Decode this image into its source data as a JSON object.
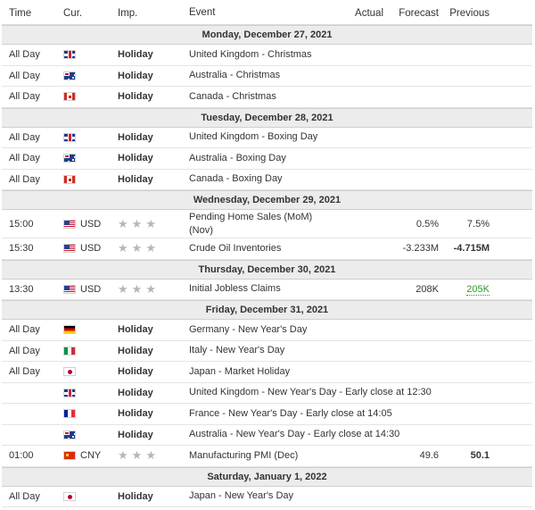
{
  "header": {
    "time": "Time",
    "currency": "Cur.",
    "importance": "Imp.",
    "event": "Event",
    "actual": "Actual",
    "forecast": "Forecast",
    "previous": "Previous"
  },
  "colors": {
    "previous_better": "#2e9a2e",
    "day_band": "#ececec"
  },
  "days": [
    {
      "label": "Monday, December 27, 2021",
      "events": [
        {
          "time": "All Day",
          "flag": "gb",
          "currency": "",
          "importance": "Holiday",
          "stars": 0,
          "event": "United Kingdom - Christmas",
          "actual": "",
          "forecast": "",
          "previous": ""
        },
        {
          "time": "All Day",
          "flag": "au",
          "currency": "",
          "importance": "Holiday",
          "stars": 0,
          "event": "Australia - Christmas",
          "actual": "",
          "forecast": "",
          "previous": ""
        },
        {
          "time": "All Day",
          "flag": "ca",
          "currency": "",
          "importance": "Holiday",
          "stars": 0,
          "event": "Canada - Christmas",
          "actual": "",
          "forecast": "",
          "previous": ""
        }
      ]
    },
    {
      "label": "Tuesday, December 28, 2021",
      "events": [
        {
          "time": "All Day",
          "flag": "gb",
          "currency": "",
          "importance": "Holiday",
          "stars": 0,
          "event": "United Kingdom - Boxing Day",
          "actual": "",
          "forecast": "",
          "previous": ""
        },
        {
          "time": "All Day",
          "flag": "au",
          "currency": "",
          "importance": "Holiday",
          "stars": 0,
          "event": "Australia - Boxing Day",
          "actual": "",
          "forecast": "",
          "previous": ""
        },
        {
          "time": "All Day",
          "flag": "ca",
          "currency": "",
          "importance": "Holiday",
          "stars": 0,
          "event": "Canada - Boxing Day",
          "actual": "",
          "forecast": "",
          "previous": ""
        }
      ]
    },
    {
      "label": "Wednesday, December 29, 2021",
      "events": [
        {
          "time": "15:00",
          "flag": "us",
          "currency": "USD",
          "importance": "",
          "stars": 3,
          "event": "Pending Home Sales (MoM)",
          "event2": "(Nov)",
          "actual": "",
          "forecast": "0.5%",
          "previous": "7.5%",
          "prev_bold": false
        },
        {
          "time": "15:30",
          "flag": "us",
          "currency": "USD",
          "importance": "",
          "stars": 3,
          "event": "Crude Oil Inventories",
          "actual": "",
          "forecast": "-3.233M",
          "previous": "-4.715M",
          "prev_bold": true
        }
      ]
    },
    {
      "label": "Thursday, December 30, 2021",
      "events": [
        {
          "time": "13:30",
          "flag": "us",
          "currency": "USD",
          "importance": "",
          "stars": 3,
          "event": "Initial Jobless Claims",
          "actual": "",
          "forecast": "208K",
          "previous": "205K",
          "prev_green": true
        }
      ]
    },
    {
      "label": "Friday, December 31, 2021",
      "events": [
        {
          "time": "All Day",
          "flag": "de",
          "currency": "",
          "importance": "Holiday",
          "stars": 0,
          "event": "Germany - New Year's Day",
          "actual": "",
          "forecast": "",
          "previous": ""
        },
        {
          "time": "All Day",
          "flag": "it",
          "currency": "",
          "importance": "Holiday",
          "stars": 0,
          "event": "Italy - New Year's Day",
          "actual": "",
          "forecast": "",
          "previous": ""
        },
        {
          "time": "All Day",
          "flag": "jp",
          "currency": "",
          "importance": "Holiday",
          "stars": 0,
          "event": "Japan - Market Holiday",
          "actual": "",
          "forecast": "",
          "previous": ""
        },
        {
          "time": "",
          "flag": "gb",
          "currency": "",
          "importance": "Holiday",
          "stars": 0,
          "event": "United Kingdom - New Year's Day - Early close at 12:30",
          "actual": "",
          "forecast": "",
          "previous": ""
        },
        {
          "time": "",
          "flag": "fr",
          "currency": "",
          "importance": "Holiday",
          "stars": 0,
          "event": "France - New Year's Day - Early close at 14:05",
          "actual": "",
          "forecast": "",
          "previous": ""
        },
        {
          "time": "",
          "flag": "au",
          "currency": "",
          "importance": "Holiday",
          "stars": 0,
          "event": "Australia - New Year's Day - Early close at 14:30",
          "actual": "",
          "forecast": "",
          "previous": ""
        },
        {
          "time": "01:00",
          "flag": "cn",
          "currency": "CNY",
          "importance": "",
          "stars": 3,
          "event": "Manufacturing PMI (Dec)",
          "actual": "",
          "forecast": "49.6",
          "previous": "50.1",
          "prev_bold": true
        }
      ]
    },
    {
      "label": "Saturday, January 1, 2022",
      "events": [
        {
          "time": "All Day",
          "flag": "jp",
          "currency": "",
          "importance": "Holiday",
          "stars": 0,
          "event": "Japan - New Year's Day",
          "actual": "",
          "forecast": "",
          "previous": ""
        }
      ]
    }
  ]
}
